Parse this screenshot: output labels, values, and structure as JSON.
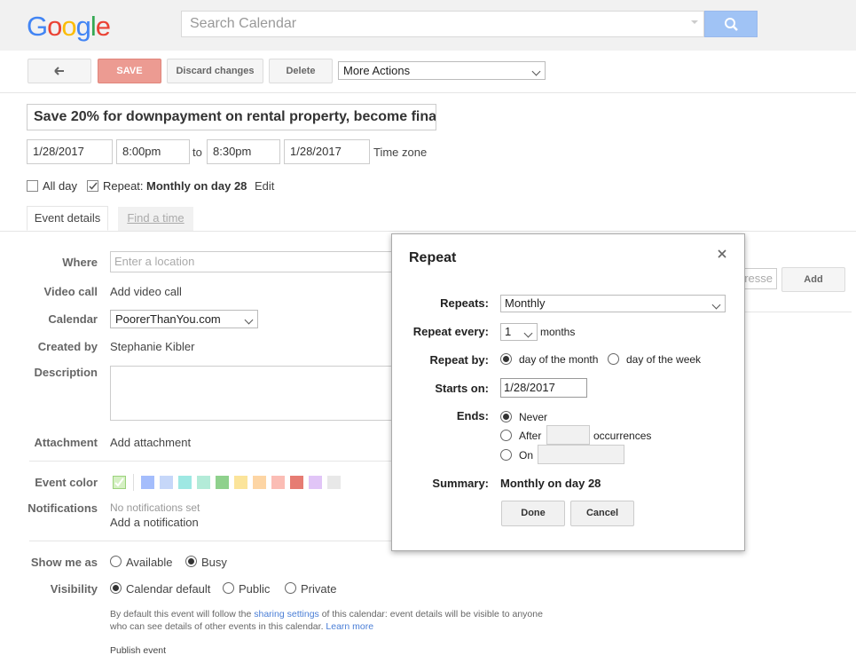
{
  "search": {
    "placeholder": "Search Calendar"
  },
  "toolbar": {
    "save": "SAVE",
    "discard": "Discard changes",
    "delete": "Delete",
    "more_actions": "More Actions"
  },
  "event": {
    "title": "Save 20% for downpayment on rental property, become fina",
    "start_date": "1/28/2017",
    "start_time": "8:00pm",
    "to": "to",
    "end_time": "8:30pm",
    "end_date": "1/28/2017",
    "timezone": "Time zone",
    "all_day": "All day",
    "repeat_label": "Repeat:",
    "repeat_value": "Monthly on day 28",
    "edit": "Edit"
  },
  "tabs": {
    "event_details": "Event details",
    "find_time": "Find a time"
  },
  "details": {
    "where_label": "Where",
    "where_placeholder": "Enter a location",
    "video_label": "Video call",
    "video_link": "Add video call",
    "calendar_label": "Calendar",
    "calendar_value": "PoorerThanYou.com",
    "created_label": "Created by",
    "created_value": "Stephanie Kibler",
    "description_label": "Description",
    "attachment_label": "Attachment",
    "attachment_link": "Add attachment",
    "color_label": "Event color",
    "colors": [
      "#a4bdfc",
      "#c6d7f9",
      "#9ee8e3",
      "#b3ebd8",
      "#8fd18d",
      "#fbe49a",
      "#fdd5a4",
      "#fbbdb5",
      "#e67c73",
      "#e1c5f7",
      "#e8e8e8"
    ],
    "notifications_label": "Notifications",
    "notifications_none": "No notifications set",
    "notifications_add": "Add a notification",
    "show_me_as_label": "Show me as",
    "available": "Available",
    "busy": "Busy",
    "visibility_label": "Visibility",
    "calendar_default": "Calendar default",
    "public": "Public",
    "private": "Private",
    "visibility_note_1": "By default this event will follow the ",
    "sharing_settings": "sharing settings",
    "visibility_note_2": " of this calendar: event details will be visible to anyone",
    "visibility_note_3": "who can see details of other events in this calendar.",
    "learn_more": "Learn more",
    "publish": "Publish event"
  },
  "guests": {
    "placeholder_fragment": "resse",
    "add": "Add"
  },
  "dialog": {
    "title": "Repeat",
    "repeats_label": "Repeats:",
    "repeats_value": "Monthly",
    "every_label": "Repeat every:",
    "every_value": "1",
    "every_unit": "months",
    "by_label": "Repeat by:",
    "by_month": "day of the month",
    "by_week": "day of the week",
    "starts_label": "Starts on:",
    "starts_value": "1/28/2017",
    "ends_label": "Ends:",
    "never": "Never",
    "after": "After",
    "occurrences": "occurrences",
    "on": "On",
    "summary_label": "Summary:",
    "summary_value": "Monthly on day 28",
    "done": "Done",
    "cancel": "Cancel"
  }
}
